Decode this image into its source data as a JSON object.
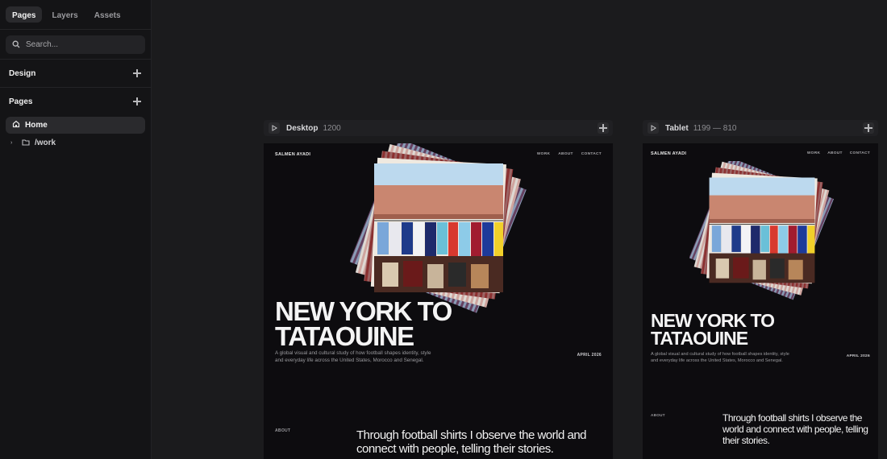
{
  "sidebar": {
    "tabs": [
      {
        "label": "Pages",
        "active": true
      },
      {
        "label": "Layers",
        "active": false
      },
      {
        "label": "Assets",
        "active": false
      }
    ],
    "search_placeholder": "Search...",
    "sections": {
      "design": "Design",
      "pages": "Pages"
    },
    "pages": [
      {
        "label": "Home",
        "icon": "home-icon",
        "active": true
      },
      {
        "label": "/work",
        "icon": "folder-icon",
        "active": false
      }
    ]
  },
  "frames": {
    "desktop": {
      "name": "Desktop",
      "size": "1200"
    },
    "tablet": {
      "name": "Tablet",
      "size": "1199 — 810"
    }
  },
  "site": {
    "brand": "SALMEN AYADI",
    "nav": [
      "WORK",
      "ABOUT",
      "CONTACT"
    ],
    "title_line1": "NEW YORK TO",
    "title_line2": "TATAOUINE",
    "description_line1": "A global visual and cultural study of how football shapes identity, style",
    "description_line2": "and everyday life across the United States, Morocco and Senegal.",
    "date": "APRIL 2026",
    "about_label": "ABOUT",
    "statement": "Through football shirts I observe the world and connect with people, telling their stories."
  },
  "colors": {
    "canvas": "#1b1b1d",
    "sidebar": "#141416",
    "frame_bg": "#0d0c0f",
    "wall": "#c98670",
    "sky": "#bcd9ee"
  }
}
